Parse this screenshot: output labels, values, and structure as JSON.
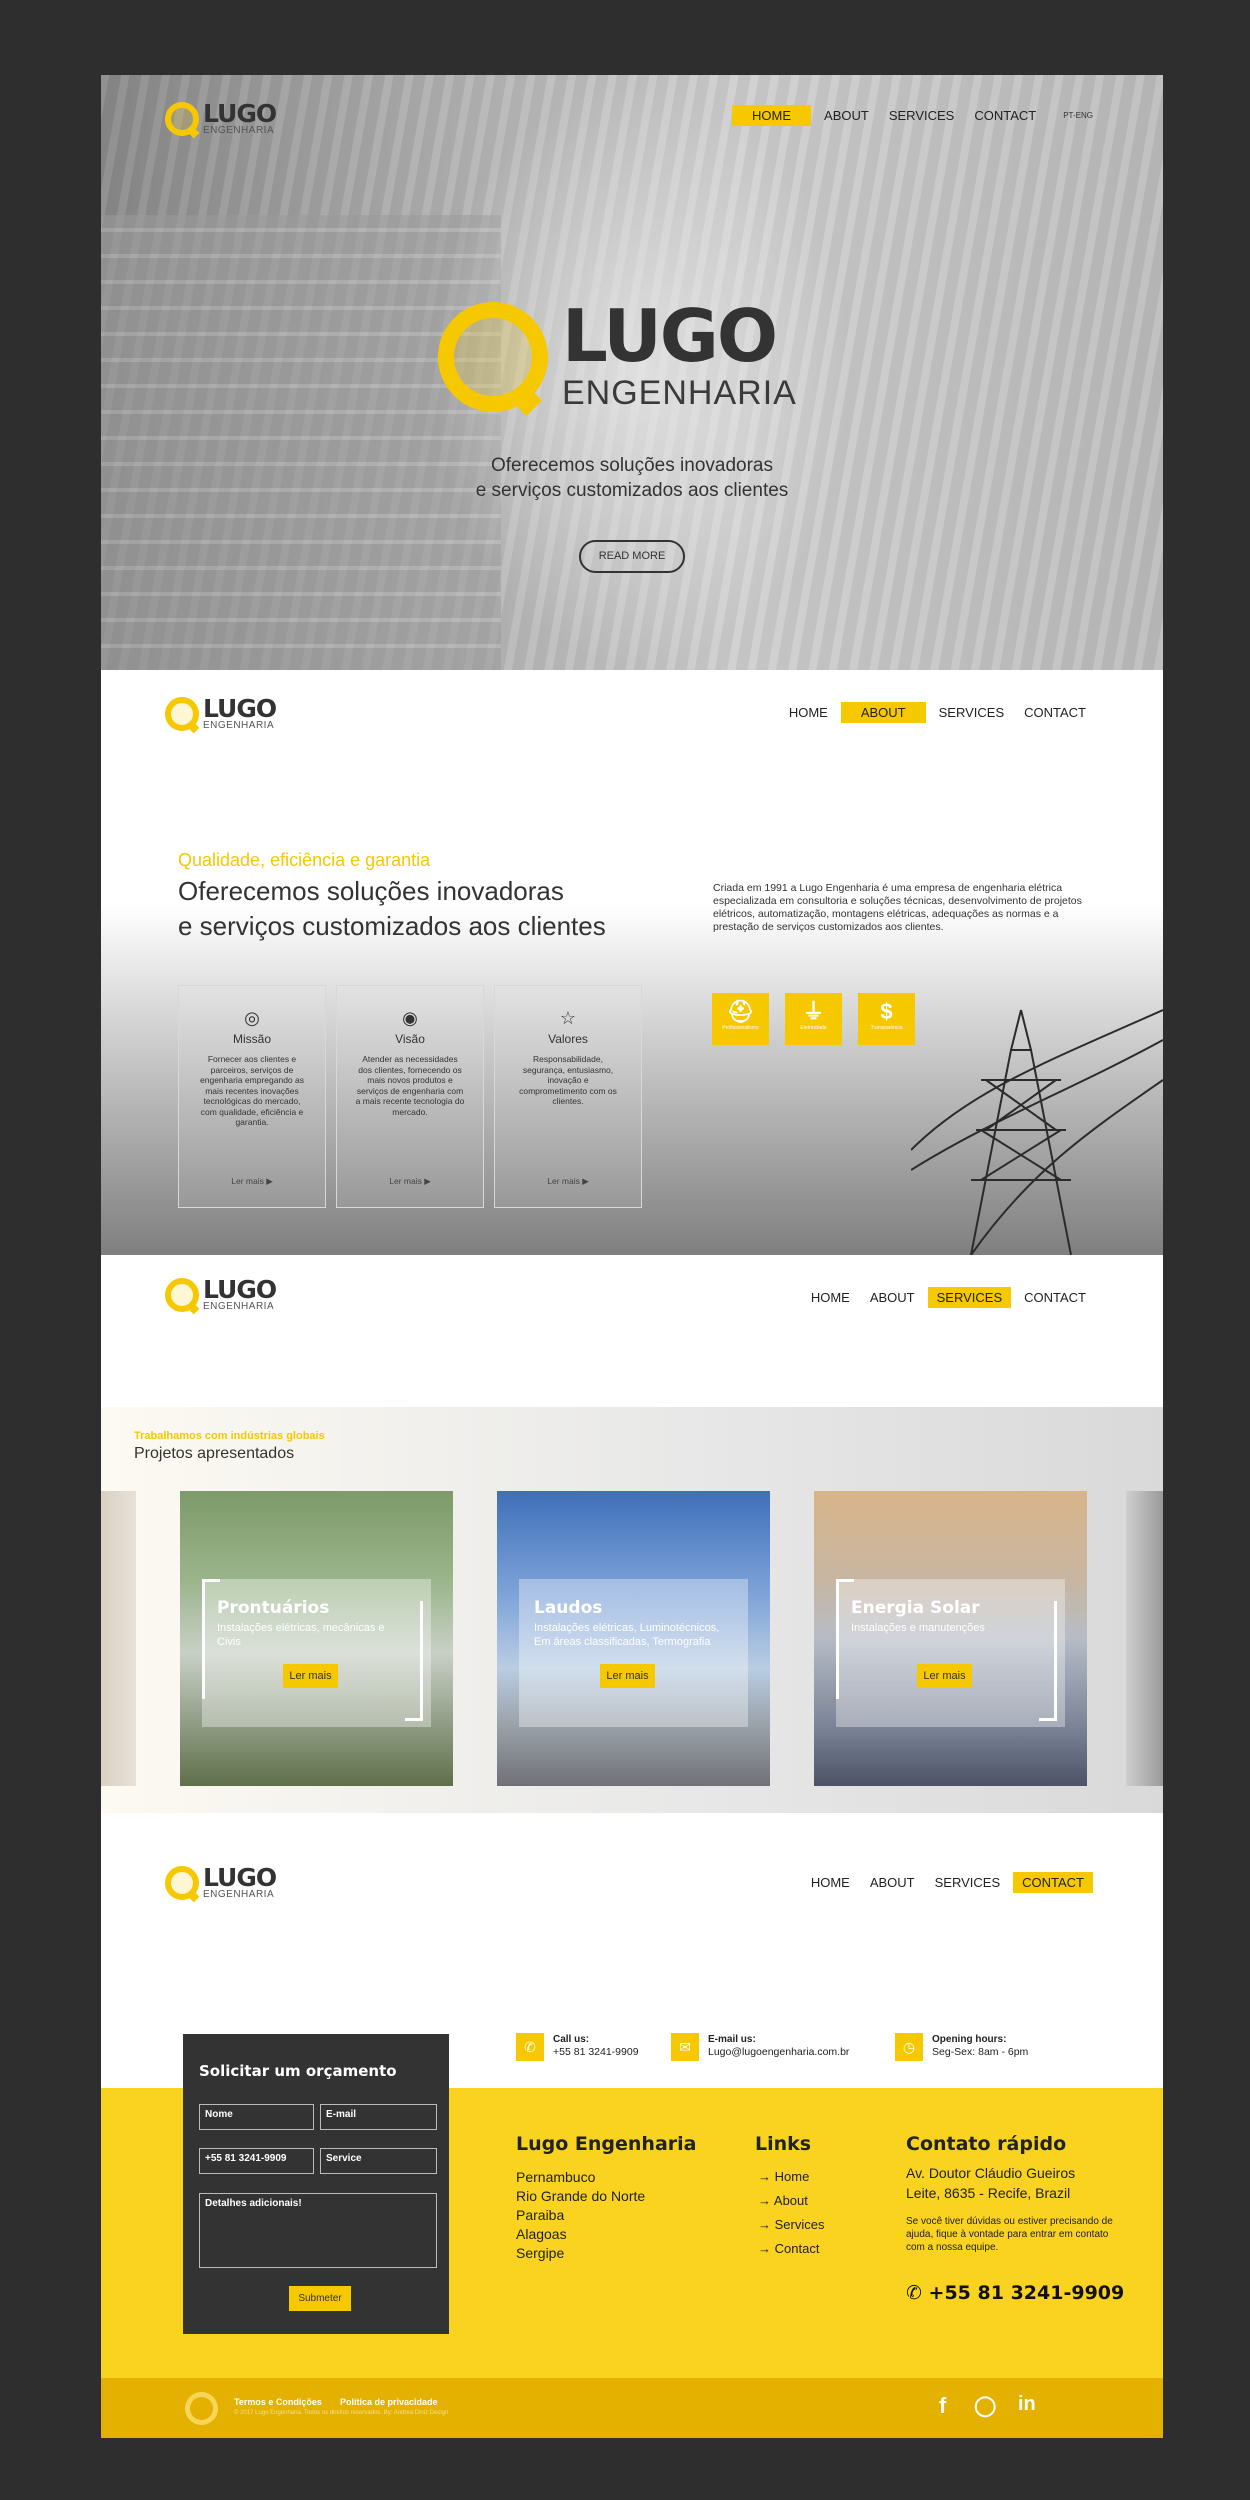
{
  "brand": {
    "name": "LUGO",
    "sub": "ENGENHARIA"
  },
  "nav": {
    "home": "HOME",
    "about": "ABOUT",
    "services": "SERVICES",
    "contact": "CONTACT",
    "lang": "PT-ENG"
  },
  "hero": {
    "line1": "Oferecemos soluções inovadoras",
    "line2": "e serviços customizados aos clientes",
    "button": "READ MORE"
  },
  "about": {
    "kicker": "Qualidade, eficiência e garantia",
    "title1": "Oferecemos soluções inovadoras",
    "title2": "e serviços customizados aos clientes",
    "description": "Criada em 1991 a Lugo Engenharia é uma empresa de engenharia elétrica especializada em consultoria e soluções técnicas, desenvolvimento de projetos elétricos, automatização, montagens elétricas, adequações as normas e a prestação de serviços customizados aos clientes.",
    "cards": [
      {
        "title": "Missão",
        "icon": "target-icon",
        "text": "Fornecer aos clientes e parceiros, serviços de engenharia empregando as mais recentes inovações tecnológicas do mercado, com qualidade, eficiência e garantia.",
        "link": "Ler mais"
      },
      {
        "title": "Visão",
        "icon": "eye-icon",
        "text": "Atender as necessidades dos clientes, fornecendo os mais novos produtos e serviços de engenharia com a mais recente tecnologia do mercado.",
        "link": "Ler mais"
      },
      {
        "title": "Valores",
        "icon": "star-icon",
        "text": "Responsabilidade, segurança, entusiasmo, inovação e comprometimento com os clientes.",
        "link": "Ler mais"
      }
    ],
    "badges": [
      {
        "icon": "helmet-icon",
        "label": "Profissionalismo"
      },
      {
        "icon": "plug-icon",
        "label": "Eletricidade"
      },
      {
        "icon": "dollar-icon",
        "label": "Transparência"
      }
    ]
  },
  "services": {
    "tag": "Trabalhamos com indústrias globais",
    "title": "Projetos apresentados",
    "projects": [
      {
        "title": "Prontuários",
        "desc": "Instalações elétricas, mecânicas e Civis",
        "button": "Ler mais"
      },
      {
        "title": "Laudos",
        "desc": "Instalações elétricas, Luminotécnicos, Em áreas classificadas, Termografia",
        "button": "Ler mais"
      },
      {
        "title": "Energia Solar",
        "desc": "Instalações e manutenções",
        "button": "Ler mais"
      }
    ]
  },
  "contact": {
    "form_title": "Solicitar um orçamento",
    "name": "Nome",
    "email": "E-mail",
    "phone": "+55 81 3241-9909",
    "service": "Service",
    "details": "Detalhes adicionais!",
    "submit": "Submeter",
    "info": [
      {
        "icon": "phone-icon",
        "label": "Call us:",
        "value": "+55 81 3241-9909"
      },
      {
        "icon": "mail-icon",
        "label": "E-mail us:",
        "value": "Lugo@lugoengenharia.com.br"
      },
      {
        "icon": "clock-icon",
        "label": "Opening hours:",
        "value": "Seg-Sex: 8am - 6pm"
      }
    ],
    "company_title": "Lugo Engenharia",
    "states": [
      "Pernambuco",
      "Rio Grande do Norte",
      "Paraiba",
      "Alagoas",
      "Sergipe"
    ],
    "links_title": "Links",
    "links": [
      "Home",
      "About",
      "Services",
      "Contact"
    ],
    "quick_title": "Contato rápido",
    "address1": "Av. Doutor Cláudio Gueiros",
    "address2": "Leite, 8635 - Recife, Brazil",
    "note": "Se você tiver dúvidas ou estiver precisando de ajuda, fique à vontade para entrar em contato com a nossa equipe."
  },
  "footer": {
    "terms": "Termos e Condições",
    "privacy": "Política de privacidade",
    "copy": "© 2017 Lugo Engenharia. Todos os direitos reservados. By: Andrea Diniz Design",
    "social": [
      "facebook-icon",
      "whatsapp-icon",
      "linkedin-icon"
    ]
  },
  "colors": {
    "accent": "#f6c800",
    "dark": "#333333",
    "bg": "#2e2e2e"
  }
}
